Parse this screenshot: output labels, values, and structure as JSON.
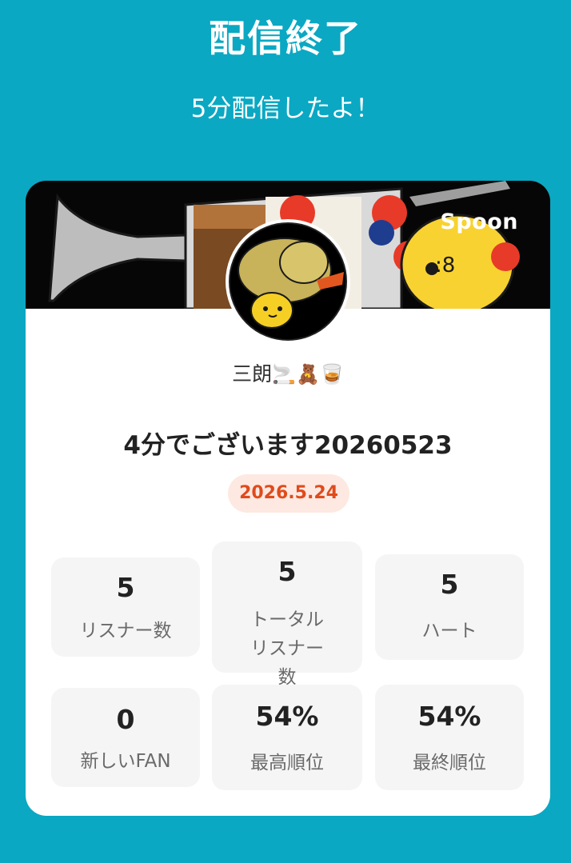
{
  "header": {
    "title": "配信終了",
    "subtitle": "5分配信したよ！"
  },
  "banner": {
    "brand": "Spoon"
  },
  "profile": {
    "username": "三朗",
    "username_emojis": "🚬🧸🥃"
  },
  "broadcast": {
    "title": "4分でございます20260523",
    "date": "2026.5.24"
  },
  "stats": [
    {
      "value": "5",
      "label": "リスナー数"
    },
    {
      "value": "5",
      "label": "トータルリスナー数"
    },
    {
      "value": "5",
      "label": "ハート"
    },
    {
      "value": "0",
      "label": "新しいFAN"
    },
    {
      "value": "54%",
      "label": "最高順位"
    },
    {
      "value": "54%",
      "label": "最終順位"
    }
  ],
  "colors": {
    "background": "#0aa8c3",
    "date_badge_bg": "#fde9e1",
    "date_badge_text": "#e04b1c"
  }
}
